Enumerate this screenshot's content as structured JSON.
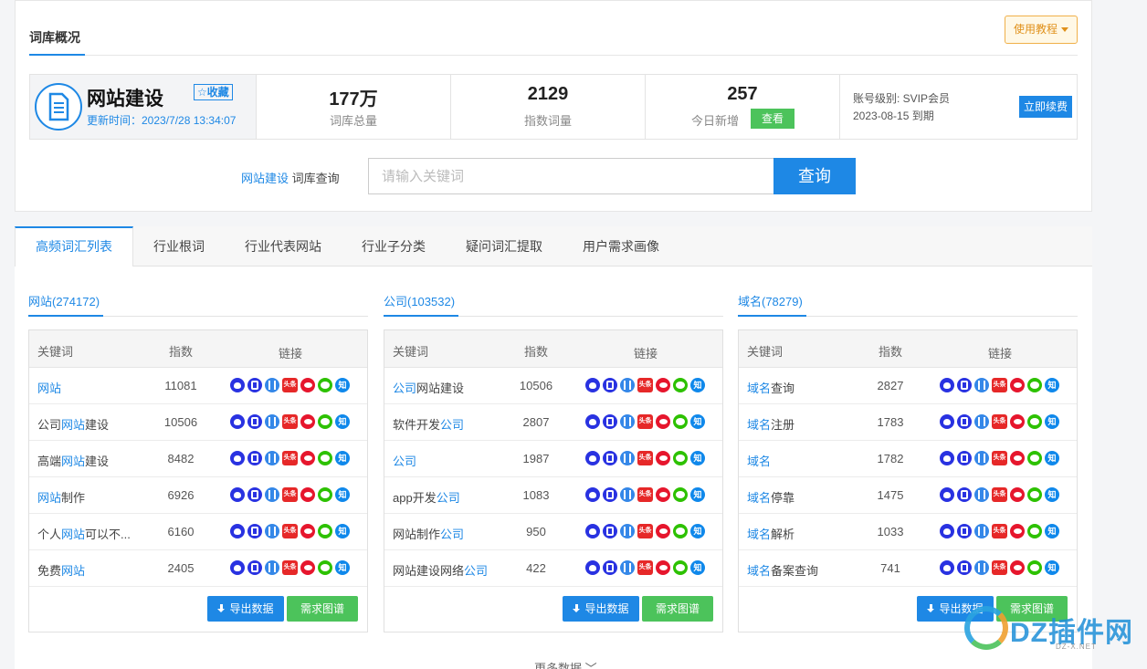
{
  "overview": {
    "title": "词库概况",
    "tutorial_label": "使用教程",
    "lexicon_name": "网站建设",
    "collect_label": "☆收藏",
    "update_time": "更新时间：2023/7/28 13:34:07",
    "stats": [
      {
        "value": "177万",
        "label": "词库总量"
      },
      {
        "value": "2129",
        "label": "指数词量"
      },
      {
        "value": "257",
        "label": "今日新增"
      }
    ],
    "view_label": "查看",
    "account_level": "账号级别: SVIP会员",
    "account_expire": "2023-08-15 到期",
    "renew_label": "立即续费"
  },
  "search": {
    "prefix_link": "网站建设",
    "prefix_text": " 词库查询",
    "placeholder": "请输入关键词",
    "button_label": "查询"
  },
  "tabs": [
    "高频词汇列表",
    "行业根词",
    "行业代表网站",
    "行业子分类",
    "疑问词汇提取",
    "用户需求画像"
  ],
  "table_headers": {
    "keyword": "关键词",
    "index": "指数",
    "links": "链接"
  },
  "columns": [
    {
      "title": "网站(274172)",
      "rows": [
        {
          "pre": "",
          "hl": "网站",
          "post": "",
          "index": "11081"
        },
        {
          "pre": "公司",
          "hl": "网站",
          "post": "建设",
          "index": "10506"
        },
        {
          "pre": "高端",
          "hl": "网站",
          "post": "建设",
          "index": "8482"
        },
        {
          "pre": "",
          "hl": "网站",
          "post": "制作",
          "index": "6926"
        },
        {
          "pre": "个人",
          "hl": "网站",
          "post": "可以不...",
          "index": "6160"
        },
        {
          "pre": "免费",
          "hl": "网站",
          "post": "",
          "index": "2405"
        }
      ]
    },
    {
      "title": "公司(103532)",
      "rows": [
        {
          "pre": "",
          "hl": "公司",
          "post": "网站建设",
          "index": "10506"
        },
        {
          "pre": "软件开发",
          "hl": "公司",
          "post": "",
          "index": "2807"
        },
        {
          "pre": "",
          "hl": "公司",
          "post": "",
          "index": "1987"
        },
        {
          "pre": "app开发",
          "hl": "公司",
          "post": "",
          "index": "1083"
        },
        {
          "pre": "网站制作",
          "hl": "公司",
          "post": "",
          "index": "950"
        },
        {
          "pre": "网站建设网络",
          "hl": "公司",
          "post": "",
          "index": "422"
        }
      ]
    },
    {
      "title": "域名(78279)",
      "rows": [
        {
          "pre": "",
          "hl": "域名",
          "post": "查询",
          "index": "2827"
        },
        {
          "pre": "",
          "hl": "域名",
          "post": "注册",
          "index": "1783"
        },
        {
          "pre": "",
          "hl": "域名",
          "post": "",
          "index": "1782"
        },
        {
          "pre": "",
          "hl": "域名",
          "post": "停靠",
          "index": "1475"
        },
        {
          "pre": "",
          "hl": "域名",
          "post": "解析",
          "index": "1033"
        },
        {
          "pre": "",
          "hl": "域名",
          "post": "备案查询",
          "index": "741"
        }
      ]
    }
  ],
  "link_icons": [
    {
      "name": "baidu-icon",
      "cls": "bd",
      "glyph": ""
    },
    {
      "name": "sogou-icon",
      "cls": "sg",
      "glyph": ""
    },
    {
      "name": "shenma-icon",
      "cls": "sm",
      "glyph": ""
    },
    {
      "name": "toutiao-icon",
      "cls": "tt",
      "glyph": "头条"
    },
    {
      "name": "weibo-icon",
      "cls": "wb",
      "glyph": ""
    },
    {
      "name": "wechat-icon",
      "cls": "wx",
      "glyph": ""
    },
    {
      "name": "zhihu-icon",
      "cls": "zh",
      "glyph": "知"
    }
  ],
  "actions": {
    "export_label": "导出数据",
    "demand_label": "需求图谱"
  },
  "more_label": "更多数据 ﹀",
  "watermark": {
    "text": "DZ插件网",
    "sub": "DZ-X.NET"
  },
  "colors": {
    "accent": "#1e88e5",
    "green": "#4cc35b",
    "warning": "#e0901a"
  }
}
